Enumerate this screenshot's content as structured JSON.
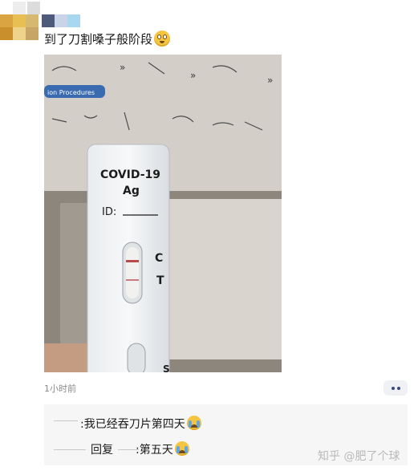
{
  "post": {
    "text": "到了刀割嗓子般阶段",
    "emoji": "flushed-face-emoji"
  },
  "photo": {
    "test_label_line1": "COVID-19",
    "test_label_line2": "Ag",
    "test_label_id": "ID:",
    "marker_c": "C",
    "marker_t": "T",
    "marker_s": "S",
    "box_banner": "ion Procedures"
  },
  "meta": {
    "time": "1小时前"
  },
  "replies": [
    {
      "text": ":我已经吞刀片第四天",
      "emoji": "crying-face-emoji"
    },
    {
      "label": "回复",
      "text": ":第五天",
      "emoji": "crying-face-emoji"
    }
  ],
  "watermark": "知乎 @肥了个球",
  "colors": {
    "reply_bg": "#f6f6f6",
    "more_button_bg": "#f0f1f5",
    "test_line": "#b84a4a"
  }
}
